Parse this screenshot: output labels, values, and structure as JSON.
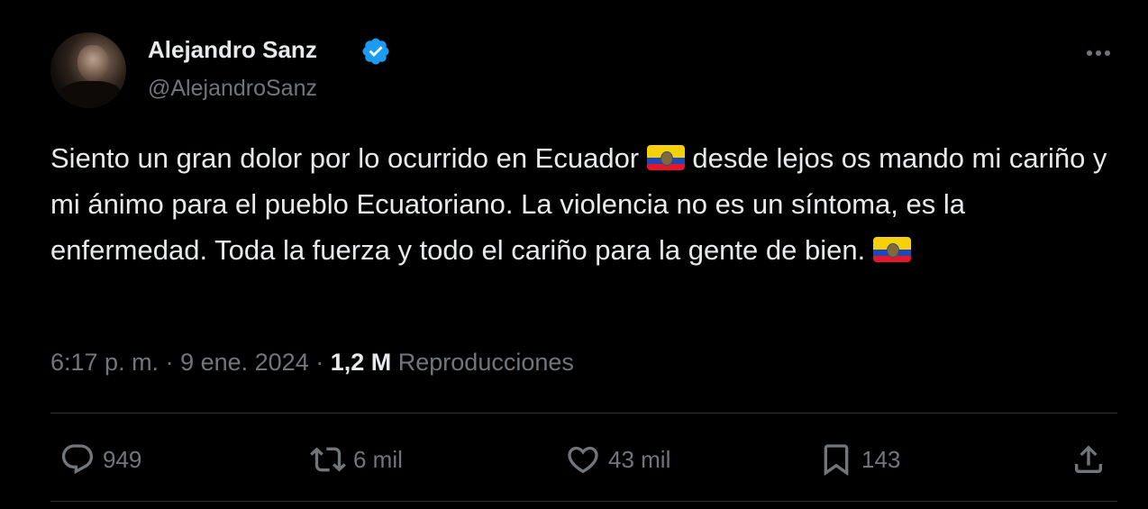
{
  "author": {
    "display_name": "Alejandro Sanz",
    "handle": "@AlejandroSanz",
    "verified": true
  },
  "tweet": {
    "text_part1": "Siento un gran dolor por lo ocurrido en Ecuador ",
    "text_part2": " desde lejos os mando mi cariño y mi ánimo para el pueblo Ecuatoriano. La violencia no es un síntoma, es la enfermedad. Toda la fuerza y todo el cariño para la gente de bien. ",
    "emoji_1": "flag-ecuador",
    "emoji_2": "flag-ecuador"
  },
  "meta": {
    "time": "6:17 p. m.",
    "separator": " · ",
    "date": "9 ene. 2024",
    "separator2": " · ",
    "views_count": "1,2 M",
    "views_label": "Reproducciones"
  },
  "actions": {
    "replies": "949",
    "reposts": "6 mil",
    "likes": "43 mil",
    "bookmarks": "143"
  },
  "icons": {
    "verified": "verified-badge-icon",
    "more": "more-options-icon",
    "reply": "reply-icon",
    "repost": "repost-icon",
    "like": "heart-icon",
    "bookmark": "bookmark-icon",
    "share": "share-icon"
  },
  "colors": {
    "background": "#000000",
    "text": "#e7e9ea",
    "muted": "#71767b",
    "verified_blue": "#1d9bf0",
    "divider": "#2f3336"
  }
}
